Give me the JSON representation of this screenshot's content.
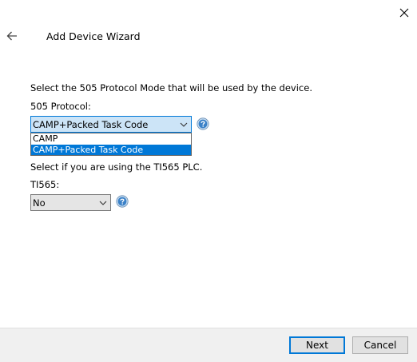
{
  "header": {
    "title": "Add Device Wizard"
  },
  "protocol_section": {
    "description": "Select the 505 Protocol Mode that will be used by the device.",
    "label": "505 Protocol:",
    "selected_value": "CAMP+Packed Task Code",
    "options": [
      "CAMP",
      "CAMP+Packed Task Code"
    ]
  },
  "ti565_section": {
    "description": "Select if you are using the TI565 PLC.",
    "label": "TI565:",
    "selected_value": "No"
  },
  "footer": {
    "next_label": "Next",
    "cancel_label": "Cancel"
  },
  "icons": {
    "close": "close-icon",
    "back": "back-arrow-icon",
    "help": "help-icon",
    "dropdown": "chevron-down-icon"
  },
  "colors": {
    "accent": "#0078d7",
    "help_icon_fill": "#3c82c8",
    "footer_bg": "#f0f0f0"
  }
}
